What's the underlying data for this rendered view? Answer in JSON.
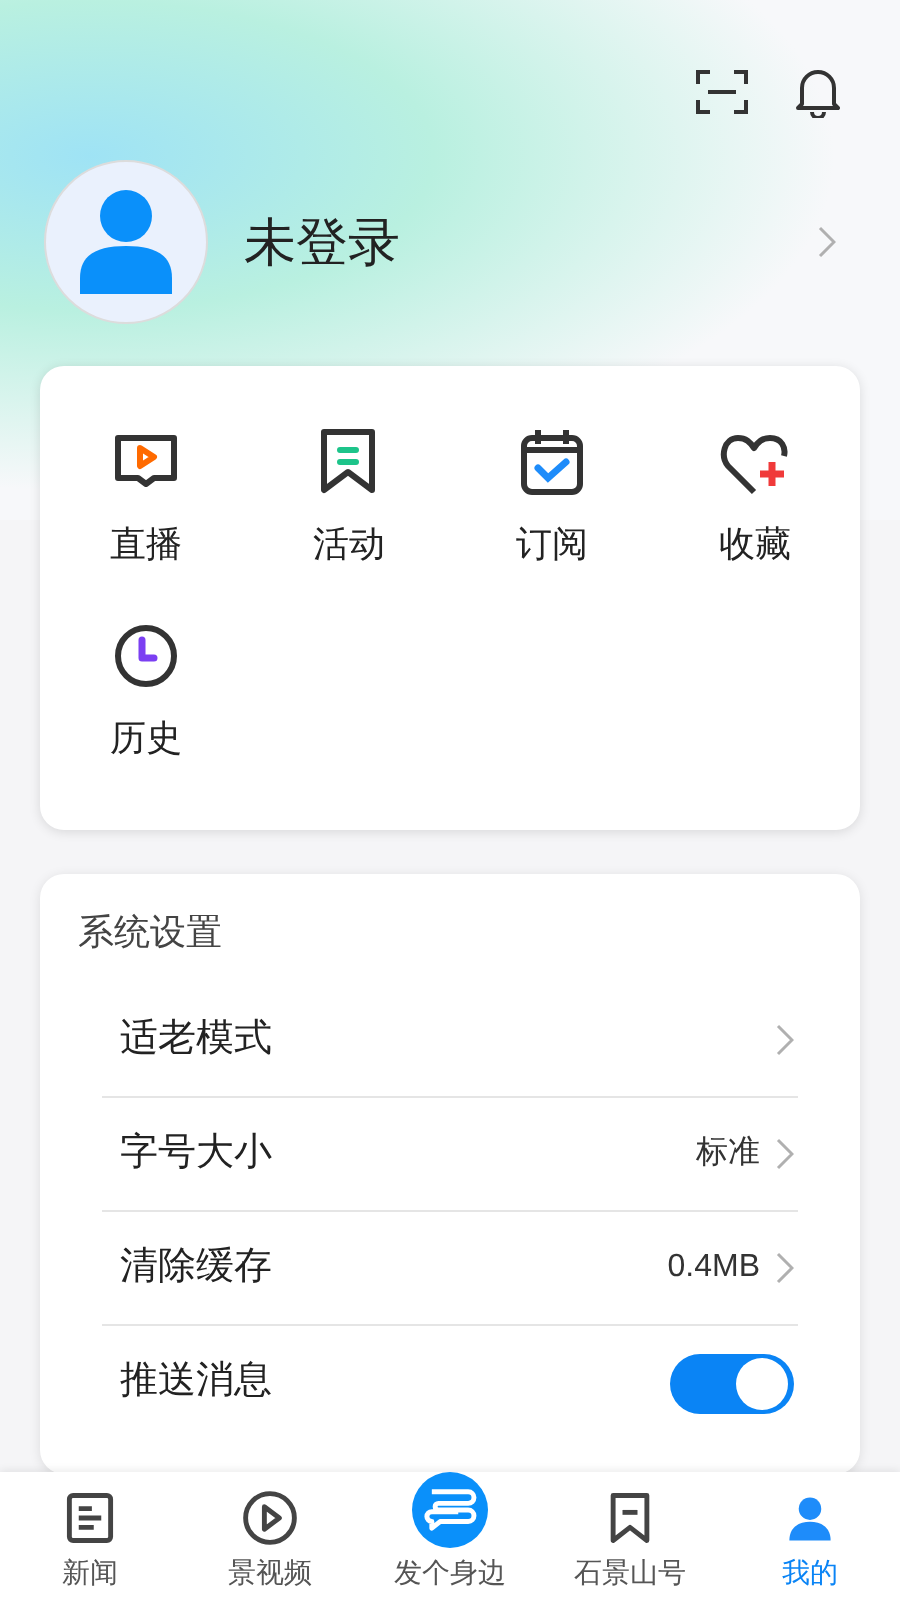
{
  "profile": {
    "name": "未登录"
  },
  "shortcuts": [
    {
      "label": "直播"
    },
    {
      "label": "活动"
    },
    {
      "label": "订阅"
    },
    {
      "label": "收藏"
    },
    {
      "label": "历史"
    }
  ],
  "settings": {
    "title": "系统设置",
    "items": [
      {
        "kind": "link",
        "label": "适老模式"
      },
      {
        "kind": "link",
        "label": "字号大小",
        "value": "标准"
      },
      {
        "kind": "link",
        "label": "清除缓存",
        "value": "0.4MB"
      },
      {
        "kind": "toggle",
        "label": "推送消息",
        "on": true
      }
    ]
  },
  "nav": [
    {
      "label": "新闻",
      "selected": false
    },
    {
      "label": "景视频",
      "selected": false
    },
    {
      "label": "发个身边",
      "selected": false
    },
    {
      "label": "石景山号",
      "selected": false
    },
    {
      "label": "我的",
      "selected": true
    }
  ]
}
